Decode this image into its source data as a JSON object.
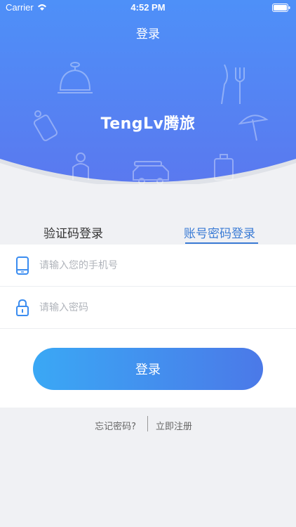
{
  "status_bar": {
    "carrier": "Carrier",
    "time": "4:52 PM"
  },
  "nav": {
    "title": "登录"
  },
  "brand": {
    "name": "TengLv腾旅"
  },
  "colors": {
    "header_gradient_top": "#4f8ef7",
    "header_gradient_bottom": "#5a7cf0",
    "accent": "#3a7bd5",
    "button_gradient_start": "#3aa8f5",
    "button_gradient_end": "#4b79e8"
  },
  "tabs": [
    {
      "label": "验证码登录",
      "active": false
    },
    {
      "label": "账号密码登录",
      "active": true
    }
  ],
  "form": {
    "phone_placeholder": "请输入您的手机号",
    "phone_icon": "phone-icon",
    "password_placeholder": "请输入密码",
    "password_icon": "lock-icon",
    "submit_label": "登录"
  },
  "links": {
    "forgot": "忘记密码?",
    "register": "立即注册"
  },
  "decorations": [
    "service-bell-icon",
    "utensils-icon",
    "luggage-tag-icon",
    "beach-umbrella-icon",
    "person-icon",
    "car-icon",
    "suitcase-icon"
  ]
}
